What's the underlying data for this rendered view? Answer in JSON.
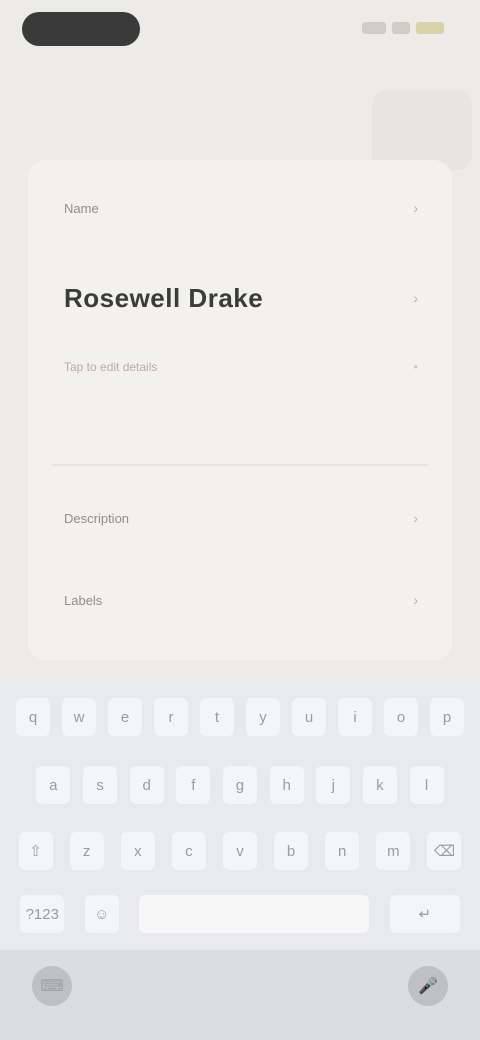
{
  "status_bar": {
    "pill_text": "",
    "icons": [
      "signal-icon",
      "wifi-icon",
      "battery-icon"
    ]
  },
  "header": {
    "action_icon": "header-action-icon"
  },
  "card": {
    "row_1_label": "Name",
    "name_value": "Rosewell Drake",
    "sub_label": "Tap to edit details",
    "sub_mark": "•",
    "description": "",
    "row_3_label": "Description",
    "row_4_label": "Labels",
    "chevron": "›"
  },
  "keyboard": {
    "row1": [
      "q",
      "w",
      "e",
      "r",
      "t",
      "y",
      "u",
      "i",
      "o",
      "p"
    ],
    "row2": [
      "a",
      "s",
      "d",
      "f",
      "g",
      "h",
      "j",
      "k",
      "l"
    ],
    "row3": [
      "⇧",
      "z",
      "x",
      "c",
      "v",
      "b",
      "n",
      "m",
      "⌫"
    ],
    "row4": [
      "?123",
      "☺",
      "",
      "↵"
    ]
  },
  "bottom_bar": {
    "left_icon": "keyboard-switch-icon",
    "right_icon": "mic-icon",
    "left_glyph": "⌨",
    "right_glyph": "🎤"
  },
  "colors": {
    "background": "#ecebe8",
    "card": "#f2f1ee",
    "keyboard": "#e9eaed",
    "accent": "#c2a7a5"
  }
}
